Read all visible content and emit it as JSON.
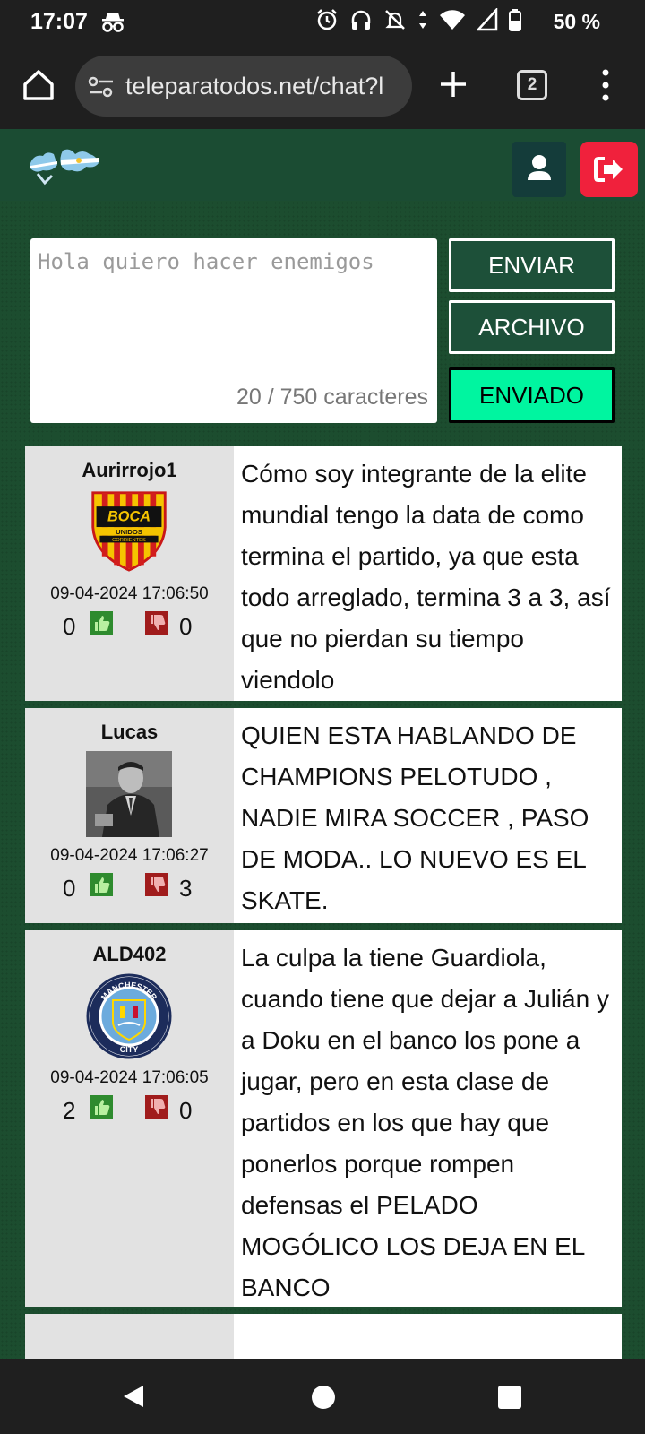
{
  "status": {
    "time": "17:07",
    "battery": "50 %",
    "icons": [
      "incognito-icon",
      "alarm-icon",
      "headphones-icon",
      "mute-icon",
      "data-arrows-icon",
      "wifi-icon",
      "signal-icon",
      "battery-icon"
    ]
  },
  "browser": {
    "url": "teleparatodos.net/chat?l",
    "tab_count": "2"
  },
  "compose": {
    "text": "Hola quiero hacer enemigos",
    "char_count": "20 / 750 caracteres",
    "send_label": "ENVIAR",
    "file_label": "ARCHIVO",
    "sent_label": "ENVIADO"
  },
  "messages": [
    {
      "user": "Aurirrojo1",
      "avatar": "boca-unidos-crest",
      "avatar_text": "BOCA UNIDOS CORRIENTES",
      "date": "09-04-2024 17:06:50",
      "likes": "0",
      "dislikes": "0",
      "text": "Cómo soy integrante de la elite mundial tengo la data de como termina el partido, ya que esta todo arreglado, termina 3 a 3, así que no pierdan su tiempo viendolo"
    },
    {
      "user": "Lucas",
      "avatar": "bw-photo",
      "date": "09-04-2024 17:06:27",
      "likes": "0",
      "dislikes": "3",
      "text": "QUIEN ESTA HABLANDO DE CHAMPIONS PELOTUDO , NADIE MIRA SOCCER , PASO DE MODA.. LO NUEVO ES EL SKATE."
    },
    {
      "user": "ALD402",
      "avatar": "manchester-city-crest",
      "avatar_text": "MANCHESTER CITY",
      "date": "09-04-2024 17:06:05",
      "likes": "2",
      "dislikes": "0",
      "text": "La culpa la tiene Guardiola, cuando tiene que dejar a Julián y a Doku en el banco los pone a jugar, pero en esta clase de partidos en los que hay que ponerlos porque rompen defensas el PELADO MOGÓLICO LOS DEJA EN EL BANCO"
    }
  ],
  "colors": {
    "header_bg": "#1b4c33",
    "page_bg": "#1c4d2f",
    "logout_bg": "#f0213c",
    "sent_bg": "#00f5a0"
  }
}
